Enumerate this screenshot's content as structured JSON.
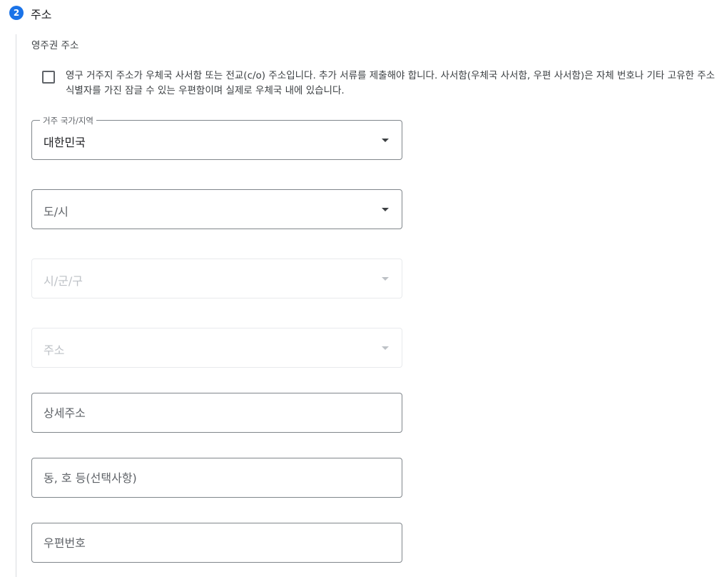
{
  "section": {
    "step_number": "2",
    "title": "주소",
    "subheading": "영주권 주소"
  },
  "po_box_checkbox": {
    "checked": false,
    "text": "영구 거주지 주소가 우체국 사서함 또는 전교(c/o) 주소입니다. 추가 서류를 제출해야 합니다. 사서함(우체국 사서함, 우편 사서함)은 자체 번호나 기타 고유한 주소 식별자를 가진 잠글 수 있는 우편함이며 실제로 우체국 내에 있습니다."
  },
  "fields": {
    "country": {
      "label": "거주 국가/지역",
      "value": "대한민국"
    },
    "province": {
      "placeholder": "도/시"
    },
    "city": {
      "placeholder": "시/군/구",
      "disabled": true
    },
    "address": {
      "placeholder": "주소",
      "disabled": true
    },
    "detail_address": {
      "placeholder": "상세주소"
    },
    "unit": {
      "placeholder": "동, 호 등(선택사항)"
    },
    "postal_code": {
      "placeholder": "우편번호"
    }
  },
  "colors": {
    "accent": "#1a73e8",
    "border": "#80868b",
    "disabled_border": "#e8eaed",
    "disabled_text": "#bdc1c6"
  }
}
